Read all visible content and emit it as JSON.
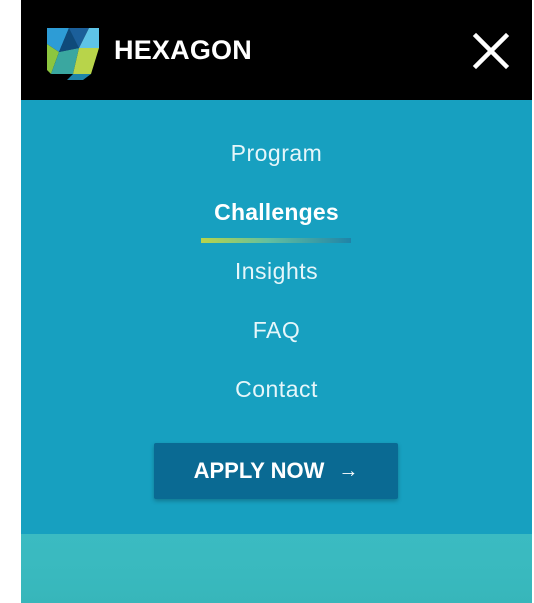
{
  "header": {
    "brand": "HEXAGON",
    "logo_icon": "hexagon-logo-icon",
    "close_icon": "close-icon"
  },
  "nav": {
    "items": [
      {
        "label": "Program",
        "active": false
      },
      {
        "label": "Challenges",
        "active": true
      },
      {
        "label": "Insights",
        "active": false
      },
      {
        "label": "FAQ",
        "active": false
      },
      {
        "label": "Contact",
        "active": false
      }
    ]
  },
  "cta": {
    "label": "APPLY NOW",
    "arrow": "→"
  },
  "colors": {
    "header_bg": "#000000",
    "menu_bg": "#17a0c0",
    "button_bg": "#0a6a93",
    "footer_bg": "#3bbbc2",
    "accent_green": "#b8d44a"
  }
}
